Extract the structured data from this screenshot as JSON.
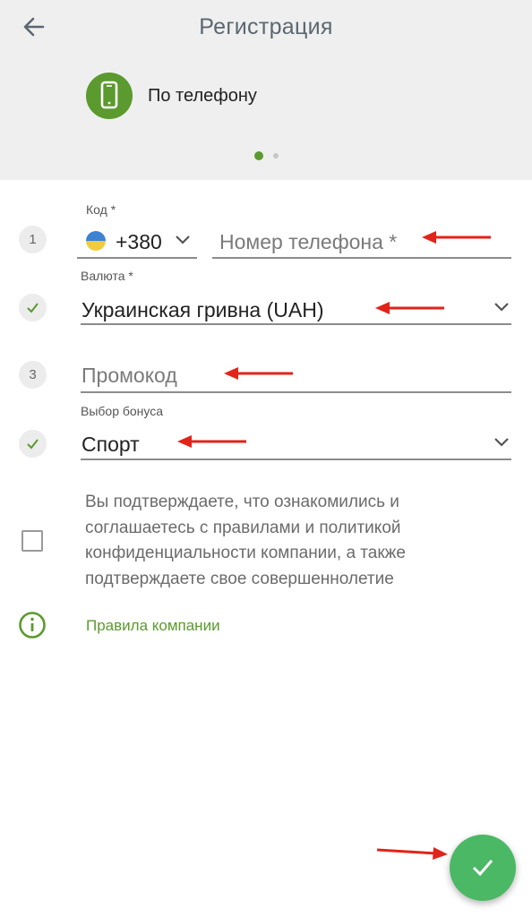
{
  "header": {
    "title": "Регистрация",
    "method_label": "По телефону",
    "back_icon": "arrow-left-icon",
    "method_icon": "smartphone-icon",
    "pager": {
      "pages": 2,
      "active": 1
    }
  },
  "form": {
    "step_phone": "1",
    "code_label": "Код *",
    "code_value": "+380",
    "phone_placeholder": "Номер телефона *",
    "currency_label": "Валюта *",
    "currency_value": "Украинская гривна (UAH)",
    "step_promo": "3",
    "promo_placeholder": "Промокод",
    "bonus_label": "Выбор бонуса",
    "bonus_value": "Спорт"
  },
  "consent": {
    "text": "Вы подтверждаете, что ознакомились и соглашаетесь с правилами и политикой конфиденциальности компании, а также подтверждаете свое совершеннолетие",
    "checked": false
  },
  "rules_link": "Правила компании",
  "fab_icon": "checkmark-icon",
  "colors": {
    "accent": "#5b9a2e",
    "fab": "#4bb865",
    "annotation_arrow": "#e2231a"
  }
}
